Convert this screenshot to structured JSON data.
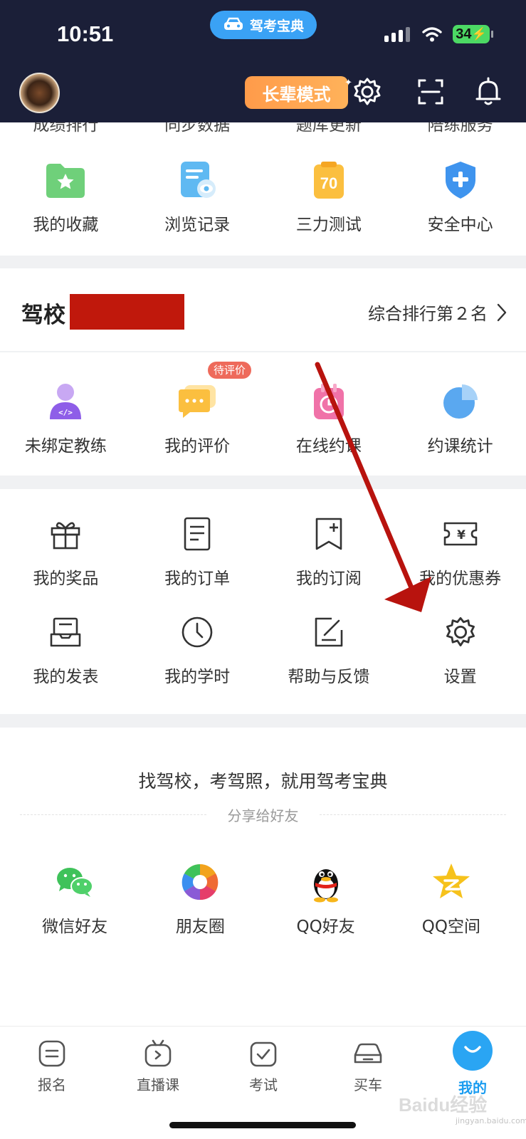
{
  "status_bar": {
    "time": "10:51",
    "app_pill": "驾考宝典",
    "battery": "34"
  },
  "header": {
    "elder_mode": "长辈模式"
  },
  "cut_row": [
    "成绩排行",
    "同步数据",
    "题库更新",
    "陪练服务"
  ],
  "tools": [
    {
      "label": "我的收藏",
      "icon": "folder-star-icon"
    },
    {
      "label": "浏览记录",
      "icon": "history-doc-icon"
    },
    {
      "label": "三力测试",
      "icon": "score-70-icon",
      "score": "70"
    },
    {
      "label": "安全中心",
      "icon": "shield-plus-icon"
    }
  ],
  "school": {
    "title": "驾校",
    "rank": "综合排行第２名"
  },
  "school_items": [
    {
      "label": "未绑定教练",
      "icon": "coach-icon"
    },
    {
      "label": "我的评价",
      "icon": "comment-icon",
      "badge": "待评价"
    },
    {
      "label": "在线约课",
      "icon": "calendar-clock-icon"
    },
    {
      "label": "约课统计",
      "icon": "pie-chart-icon"
    }
  ],
  "services_row1": [
    {
      "label": "我的奖品",
      "icon": "gift-icon"
    },
    {
      "label": "我的订单",
      "icon": "order-icon"
    },
    {
      "label": "我的订阅",
      "icon": "bookmark-plus-icon"
    },
    {
      "label": "我的优惠券",
      "icon": "coupon-icon"
    }
  ],
  "services_row2": [
    {
      "label": "我的发表",
      "icon": "inbox-icon"
    },
    {
      "label": "我的学时",
      "icon": "clock-icon"
    },
    {
      "label": "帮助与反馈",
      "icon": "feedback-icon"
    },
    {
      "label": "设置",
      "icon": "settings-gear-icon"
    }
  ],
  "share": {
    "slogan": "找驾校，考驾照，就用驾考宝典",
    "subtitle": "分享给好友",
    "items": [
      {
        "label": "微信好友",
        "icon": "wechat-icon"
      },
      {
        "label": "朋友圈",
        "icon": "moments-icon"
      },
      {
        "label": "QQ好友",
        "icon": "qq-icon"
      },
      {
        "label": "QQ空间",
        "icon": "qzone-icon"
      }
    ]
  },
  "tabs": [
    {
      "label": "报名",
      "icon": "signup-icon"
    },
    {
      "label": "直播课",
      "icon": "live-tv-icon"
    },
    {
      "label": "考试",
      "icon": "exam-icon"
    },
    {
      "label": "买车",
      "icon": "car-icon"
    },
    {
      "label": "我的",
      "icon": "me-icon",
      "active": true
    }
  ],
  "watermark": {
    "main": "Baidu经验",
    "sub": "jingyan.baidu.com"
  }
}
